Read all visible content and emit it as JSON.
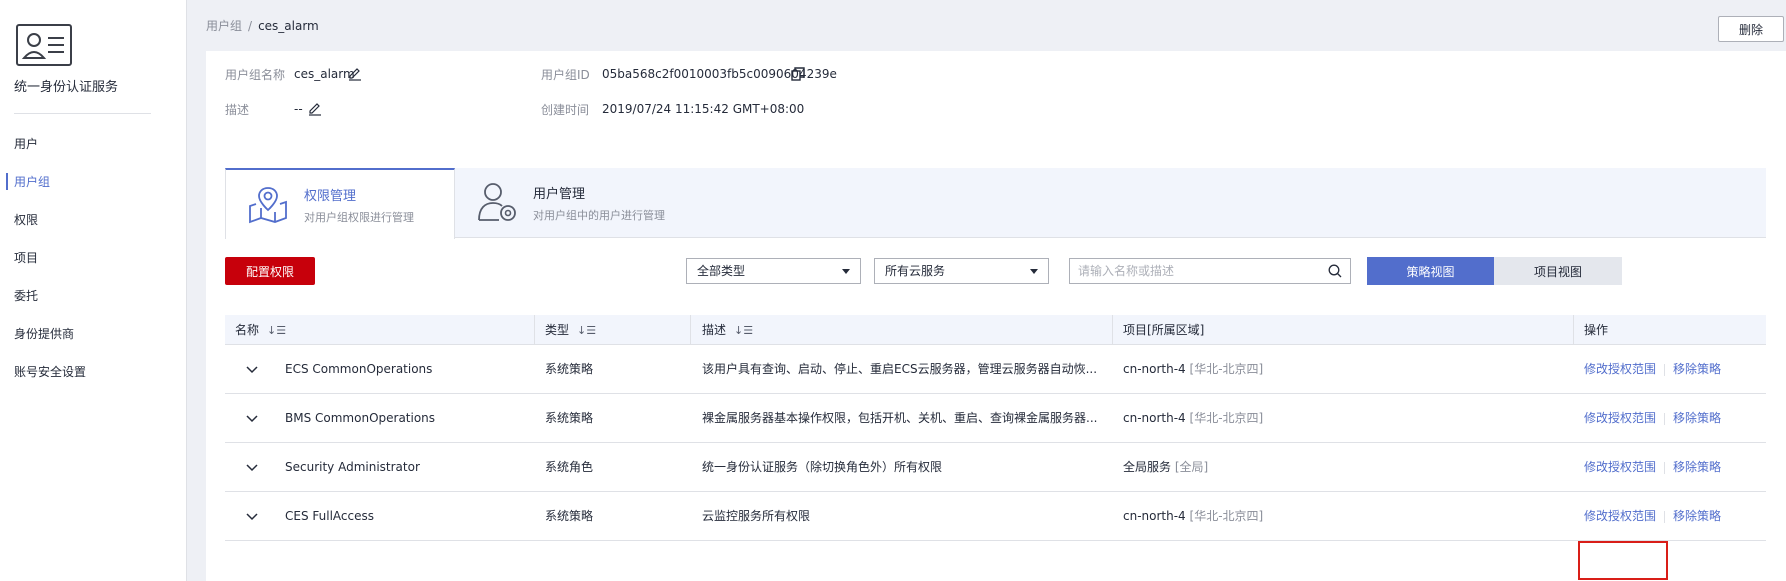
{
  "sidebar": {
    "service_title": "统一身份认证服务",
    "items": [
      {
        "label": "用户"
      },
      {
        "label": "用户组"
      },
      {
        "label": "权限"
      },
      {
        "label": "项目"
      },
      {
        "label": "委托"
      },
      {
        "label": "身份提供商"
      },
      {
        "label": "账号安全设置"
      }
    ],
    "active_index": 1
  },
  "breadcrumb": {
    "parent": "用户组",
    "separator": "/",
    "current": "ces_alarm"
  },
  "header": {
    "delete_label": "删除"
  },
  "info": {
    "name_label": "用户组名称",
    "name_value": "ces_alarm",
    "id_label": "用户组ID",
    "id_value": "05ba568c2f0010003fb5c0090604239e",
    "desc_label": "描述",
    "desc_value": "--",
    "created_label": "创建时间",
    "created_value": "2019/07/24 11:15:42 GMT+08:00"
  },
  "tabs": [
    {
      "title": "权限管理",
      "desc": "对用户组权限进行管理",
      "icon": "map-pin-icon"
    },
    {
      "title": "用户管理",
      "desc": "对用户组中的用户进行管理",
      "icon": "user-gear-icon"
    }
  ],
  "toolbar": {
    "config_label": "配置权限",
    "type_select": "全部类型",
    "service_select": "所有云服务",
    "search_placeholder": "请输入名称或描述",
    "policy_view_label": "策略视图",
    "project_view_label": "项目视图"
  },
  "table": {
    "headers": {
      "name": "名称",
      "type": "类型",
      "desc": "描述",
      "project": "项目[所属区域]",
      "ops": "操作"
    },
    "rows": [
      {
        "name": "ECS CommonOperations",
        "type": "系统策略",
        "desc": "该用户具有查询、启动、停止、重启ECS云服务器，管理云服务器自动恢...",
        "project": "cn-north-4",
        "region": "[华北-北京四]",
        "op_modify": "修改授权范围",
        "op_remove": "移除策略"
      },
      {
        "name": "BMS CommonOperations",
        "type": "系统策略",
        "desc": "裸金属服务器基本操作权限，包括开机、关机、重启、查询裸金属服务器...",
        "project": "cn-north-4",
        "region": "[华北-北京四]",
        "op_modify": "修改授权范围",
        "op_remove": "移除策略"
      },
      {
        "name": "Security Administrator",
        "type": "系统角色",
        "desc": "统一身份认证服务（除切换角色外）所有权限",
        "project": "全局服务",
        "region": "[全局]",
        "op_modify": "修改授权范围",
        "op_remove": "移除策略"
      },
      {
        "name": "CES FullAccess",
        "type": "系统策略",
        "desc": "云监控服务所有权限",
        "project": "cn-north-4",
        "region": "[华北-北京四]",
        "op_modify": "修改授权范围",
        "op_remove": "移除策略"
      }
    ]
  },
  "colors": {
    "accent": "#526ecc",
    "primary_red": "#c7000b",
    "highlight_box": "#d91e18"
  }
}
